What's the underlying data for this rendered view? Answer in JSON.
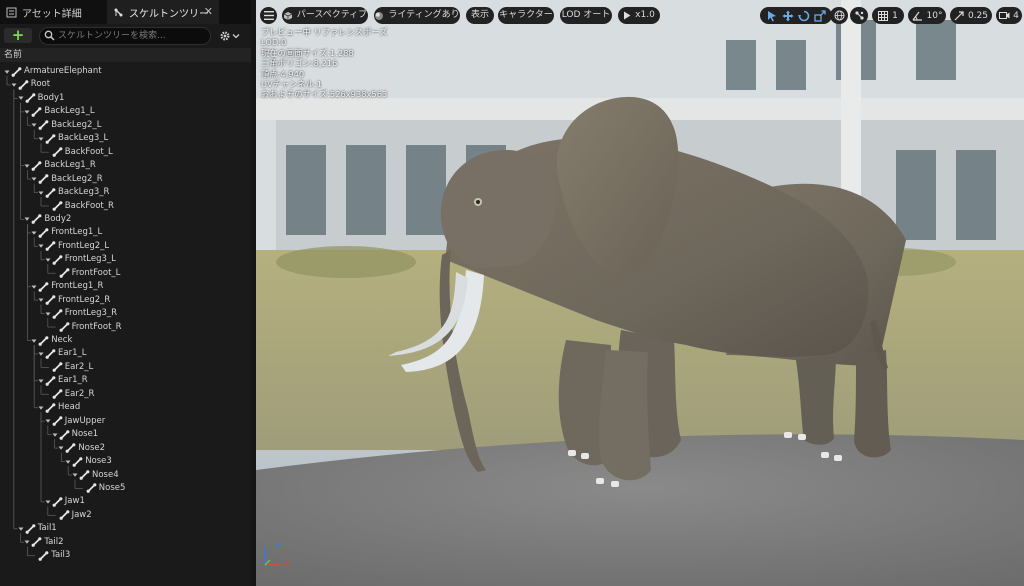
{
  "tabs": [
    {
      "label": "アセット詳細",
      "icon": "asset-details-icon"
    },
    {
      "label": "スケルトンツリー",
      "icon": "skeleton-tree-icon",
      "active": true
    }
  ],
  "toolbar": {
    "add_label": "+",
    "search_placeholder": "スケルトンツリーを検索...",
    "settings_icon": "gear-icon"
  },
  "tree": {
    "header": "名前",
    "rows": [
      {
        "label": "ArmatureElephant",
        "depth": 0
      },
      {
        "label": "Root",
        "depth": 1
      },
      {
        "label": "Body1",
        "depth": 2
      },
      {
        "label": "BackLeg1_L",
        "depth": 3
      },
      {
        "label": "BackLeg2_L",
        "depth": 4
      },
      {
        "label": "BackLeg3_L",
        "depth": 5
      },
      {
        "label": "BackFoot_L",
        "depth": 6
      },
      {
        "label": "BackLeg1_R",
        "depth": 3
      },
      {
        "label": "BackLeg2_R",
        "depth": 4
      },
      {
        "label": "BackLeg3_R",
        "depth": 5
      },
      {
        "label": "BackFoot_R",
        "depth": 6
      },
      {
        "label": "Body2",
        "depth": 3
      },
      {
        "label": "FrontLeg1_L",
        "depth": 4
      },
      {
        "label": "FrontLeg2_L",
        "depth": 5
      },
      {
        "label": "FrontLeg3_L",
        "depth": 6
      },
      {
        "label": "FrontFoot_L",
        "depth": 7
      },
      {
        "label": "FrontLeg1_R",
        "depth": 4
      },
      {
        "label": "FrontLeg2_R",
        "depth": 5
      },
      {
        "label": "FrontLeg3_R",
        "depth": 6
      },
      {
        "label": "FrontFoot_R",
        "depth": 7
      },
      {
        "label": "Neck",
        "depth": 4
      },
      {
        "label": "Ear1_L",
        "depth": 5
      },
      {
        "label": "Ear2_L",
        "depth": 6
      },
      {
        "label": "Ear1_R",
        "depth": 5
      },
      {
        "label": "Ear2_R",
        "depth": 6
      },
      {
        "label": "Head",
        "depth": 5
      },
      {
        "label": "JawUpper",
        "depth": 6
      },
      {
        "label": "Nose1",
        "depth": 7
      },
      {
        "label": "Nose2",
        "depth": 8
      },
      {
        "label": "Nose3",
        "depth": 9
      },
      {
        "label": "Nose4",
        "depth": 10
      },
      {
        "label": "Nose5",
        "depth": 11
      },
      {
        "label": "Jaw1",
        "depth": 6
      },
      {
        "label": "Jaw2",
        "depth": 7
      },
      {
        "label": "Tail1",
        "depth": 2
      },
      {
        "label": "Tail2",
        "depth": 3
      },
      {
        "label": "Tail3",
        "depth": 4
      }
    ]
  },
  "viewport": {
    "menu_icon": "hamburger-menu-icon",
    "perspective": "パースペクティブ",
    "lighting": "ライティングあり",
    "show": "表示",
    "character": "キャラクター",
    "lod": "LOD オート",
    "play_speed": "x1.0",
    "grid_value": "1",
    "angle_value": "10°",
    "scale_value": "0.25",
    "camera_value": "4",
    "info_lines": [
      "プレビュー中 リファレンスポーズ",
      "LOD:0",
      "現在の画面サイズ:1.288",
      "三角ポリゴン:8,216",
      "頂点:4,940",
      "UVチャンネル:1",
      "おおよそのサイズ:526x938x563"
    ],
    "axis_labels": {
      "x": "X",
      "z": "Z"
    }
  },
  "colors": {
    "accent_green": "#7ed957",
    "panel_bg": "#1a1a1a",
    "header_bg": "#232323",
    "axis_x": "#d94a3a",
    "axis_y": "#5cc44a",
    "axis_z": "#3a7bd9"
  }
}
